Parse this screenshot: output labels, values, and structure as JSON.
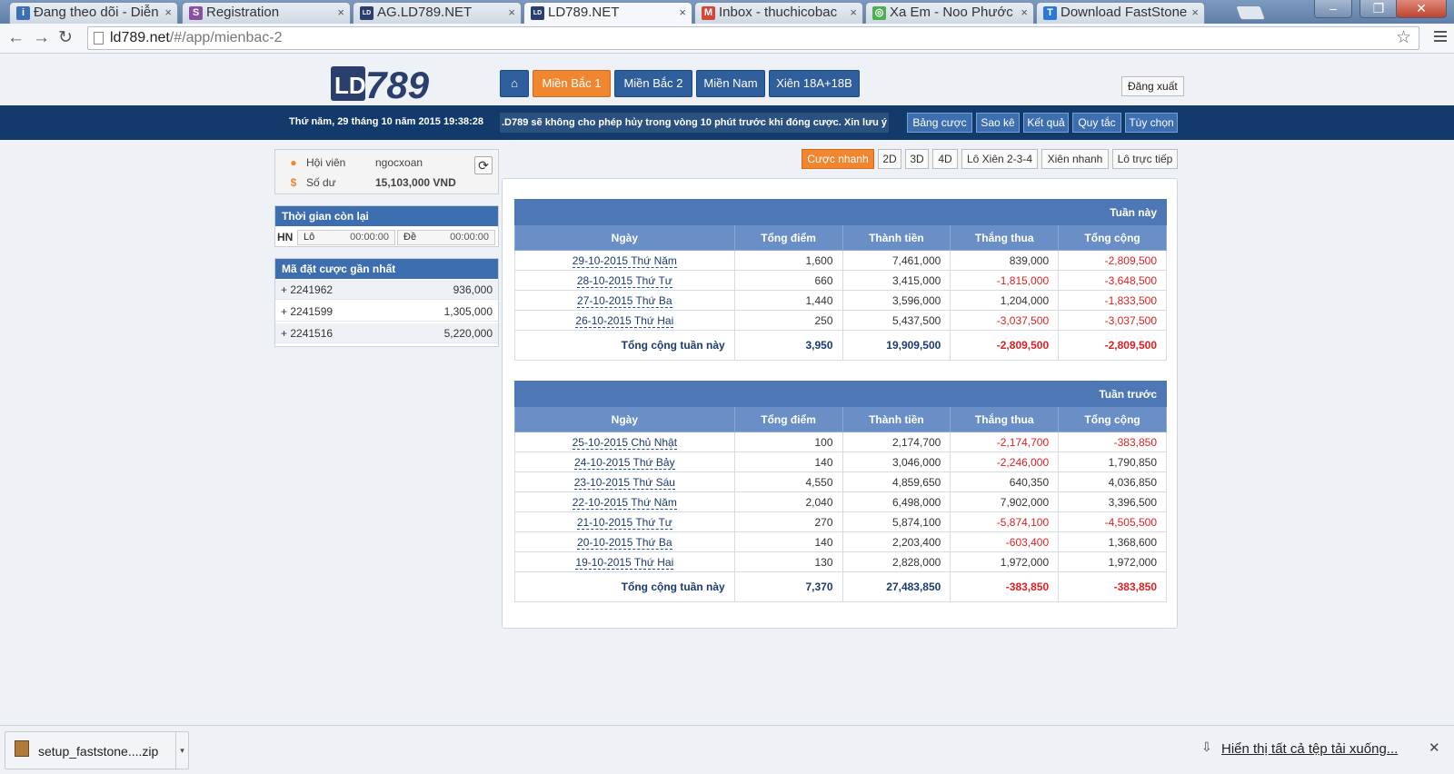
{
  "browser": {
    "tabs": [
      {
        "title": "Đang theo dõi - Diễn",
        "icon_color": "#3b6fb6",
        "icon_letter": "i"
      },
      {
        "title": "Registration",
        "icon_color": "#8a4fa0",
        "icon_letter": "S"
      },
      {
        "title": "AG.LD789.NET",
        "icon_color": "#2a3f6e",
        "icon_letter": "LD"
      },
      {
        "title": "LD789.NET",
        "icon_color": "#2a3f6e",
        "icon_letter": "LD"
      },
      {
        "title": "Inbox - thuchicobac",
        "icon_color": "#d44638",
        "icon_letter": "M"
      },
      {
        "title": "Xa Em - Noo Phước",
        "icon_color": "#4caf50",
        "icon_letter": "◎"
      },
      {
        "title": "Download FastStone",
        "icon_color": "#2b78d0",
        "icon_letter": "T"
      }
    ],
    "active_tab_index": 3,
    "url_domain": "ld789.net",
    "url_path": "/#/app/mienbac-2"
  },
  "site": {
    "logo_text": "LD789",
    "nav": [
      {
        "label": "⌂",
        "icon": "home-icon"
      },
      {
        "label": "Miền Bắc 1",
        "active": true
      },
      {
        "label": "Miền Bắc 2"
      },
      {
        "label": "Miền Nam"
      },
      {
        "label": "Xiên 18A+18B"
      }
    ],
    "logout_label": "Đăng xuất",
    "datetime": "Thứ năm, 29 tháng 10 năm 2015 19:38:28",
    "marquee_text": ".D789 sẽ không cho phép hủy trong vòng 10 phút trước khi đóng cược. Xin lưu ý",
    "top_buttons": [
      "Bảng cược",
      "Sao kê",
      "Kết quả",
      "Quy tắc",
      "Tùy chọn"
    ]
  },
  "user": {
    "member_label": "Hội viên",
    "member_value": "ngocxoan",
    "balance_label": "Số dư",
    "balance_value": "15,103,000 VND"
  },
  "time_remaining": {
    "title": "Thời gian còn lại",
    "region": "HN",
    "lo_label": "Lô",
    "lo_value": "00:00:00",
    "de_label": "Đề",
    "de_value": "00:00:00"
  },
  "recent_bets": {
    "title": "Mã đặt cược gần nhất",
    "items": [
      {
        "code": "2241962",
        "amount": "936,000"
      },
      {
        "code": "2241599",
        "amount": "1,305,000"
      },
      {
        "code": "2241516",
        "amount": "5,220,000"
      }
    ]
  },
  "subnav": [
    "Cược nhanh",
    "2D",
    "3D",
    "4D",
    "Lô Xiên 2-3-4",
    "Xiên nhanh",
    "Lô trực tiếp"
  ],
  "columns": [
    "Ngày",
    "Tổng điểm",
    "Thành tiền",
    "Thắng thua",
    "Tổng cộng"
  ],
  "tables": [
    {
      "caption": "Tuần này",
      "rows": [
        {
          "date": "29-10-2015 Thứ Năm",
          "points": "1,600",
          "amount": "7,461,000",
          "winloss": "839,000",
          "total": "-2,809,500"
        },
        {
          "date": "28-10-2015 Thứ Tư",
          "points": "660",
          "amount": "3,415,000",
          "winloss": "-1,815,000",
          "total": "-3,648,500"
        },
        {
          "date": "27-10-2015 Thứ Ba",
          "points": "1,440",
          "amount": "3,596,000",
          "winloss": "1,204,000",
          "total": "-1,833,500"
        },
        {
          "date": "26-10-2015 Thứ Hai",
          "points": "250",
          "amount": "5,437,500",
          "winloss": "-3,037,500",
          "total": "-3,037,500"
        }
      ],
      "total": {
        "label": "Tổng cộng tuần này",
        "points": "3,950",
        "amount": "19,909,500",
        "winloss": "-2,809,500",
        "total": "-2,809,500"
      }
    },
    {
      "caption": "Tuần trước",
      "rows": [
        {
          "date": "25-10-2015 Chủ Nhật",
          "points": "100",
          "amount": "2,174,700",
          "winloss": "-2,174,700",
          "total": "-383,850"
        },
        {
          "date": "24-10-2015 Thứ Bảy",
          "points": "140",
          "amount": "3,046,000",
          "winloss": "-2,246,000",
          "total": "1,790,850"
        },
        {
          "date": "23-10-2015 Thứ Sáu",
          "points": "4,550",
          "amount": "4,859,650",
          "winloss": "640,350",
          "total": "4,036,850"
        },
        {
          "date": "22-10-2015 Thứ Năm",
          "points": "2,040",
          "amount": "6,498,000",
          "winloss": "7,902,000",
          "total": "3,396,500"
        },
        {
          "date": "21-10-2015 Thứ Tư",
          "points": "270",
          "amount": "5,874,100",
          "winloss": "-5,874,100",
          "total": "-4,505,500"
        },
        {
          "date": "20-10-2015 Thứ Ba",
          "points": "140",
          "amount": "2,203,400",
          "winloss": "-603,400",
          "total": "1,368,600"
        },
        {
          "date": "19-10-2015 Thứ Hai",
          "points": "130",
          "amount": "2,828,000",
          "winloss": "1,972,000",
          "total": "1,972,000"
        }
      ],
      "total": {
        "label": "Tổng cộng tuần này",
        "points": "7,370",
        "amount": "27,483,850",
        "winloss": "-383,850",
        "total": "-383,850"
      }
    }
  ],
  "downloads": {
    "file_name": "setup_faststone....zip",
    "show_all_label": "Hiển thị tất cả tệp tải xuống..."
  },
  "colors": {
    "nav_blue": "#2f5e9c",
    "accent_orange": "#f0862f",
    "infobar": "#123b6b",
    "negative": "#e02020"
  }
}
